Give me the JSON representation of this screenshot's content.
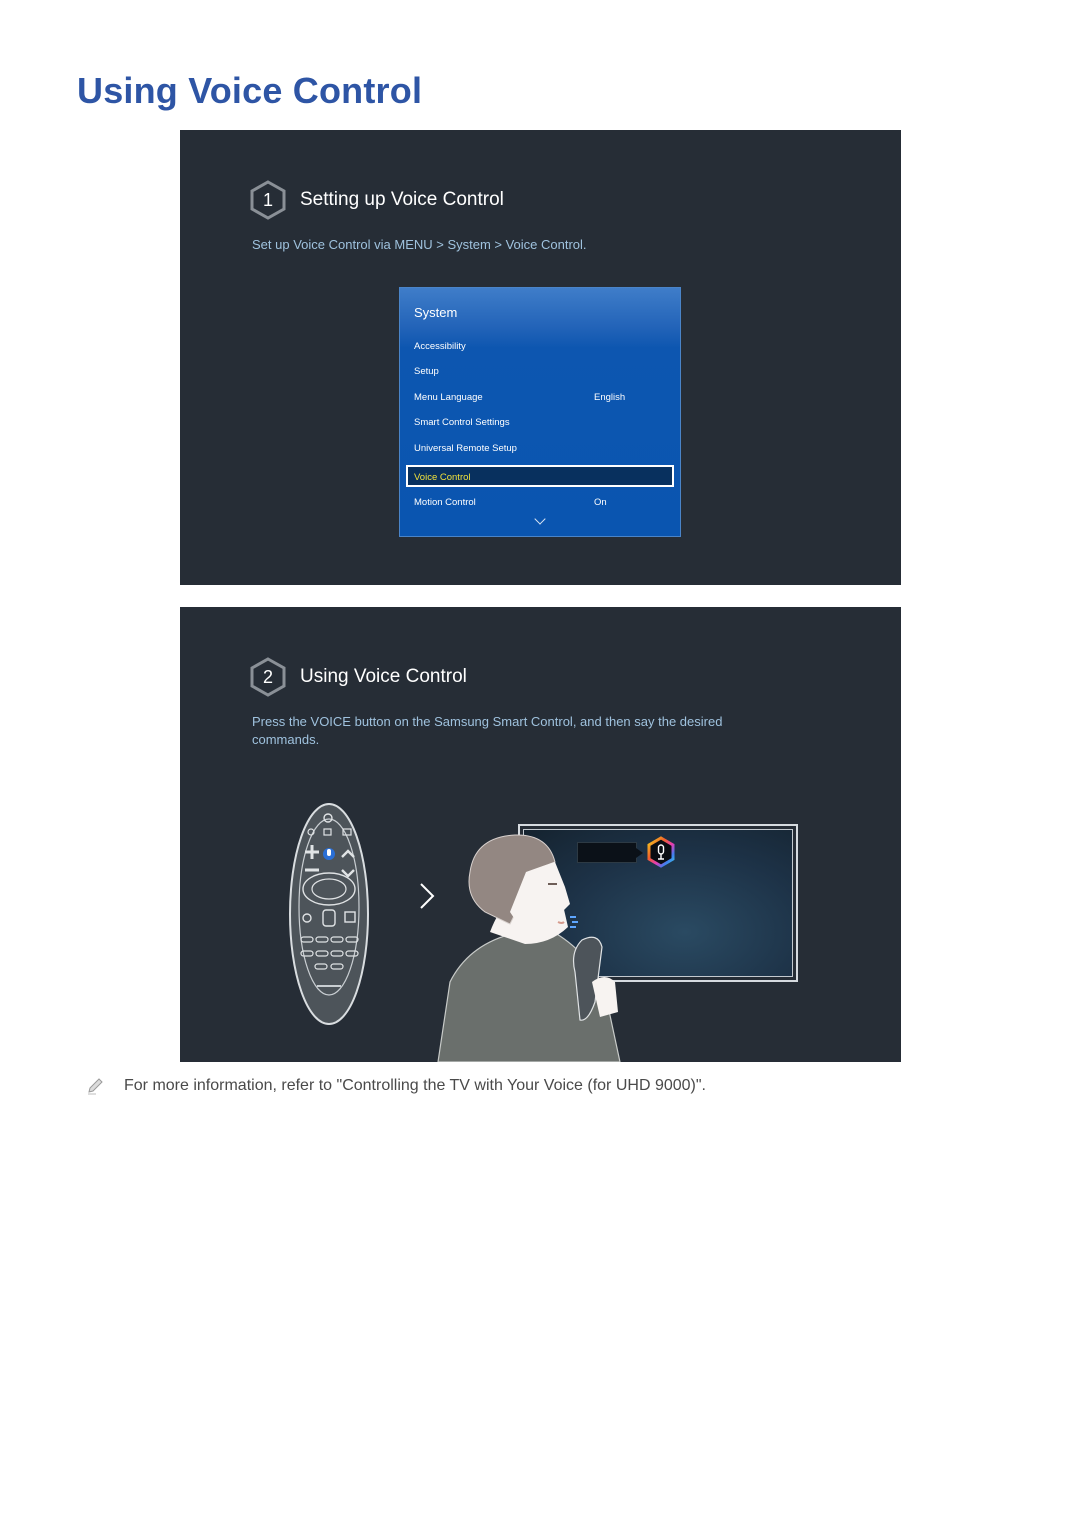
{
  "page": {
    "title": "Using Voice Control",
    "accent_color": "#2e55a5"
  },
  "step1": {
    "number": "1",
    "title": "Setting up Voice Control",
    "description": "Set up Voice Control via MENU > System > Voice Control.",
    "menu": {
      "title": "System",
      "items": [
        {
          "label": "Accessibility",
          "value": ""
        },
        {
          "label": "Setup",
          "value": ""
        },
        {
          "label": "Menu Language",
          "value": "English"
        },
        {
          "label": "Smart Control Settings",
          "value": ""
        },
        {
          "label": "Universal Remote Setup",
          "value": ""
        },
        {
          "label": "Voice Control",
          "value": "",
          "selected": true
        },
        {
          "label": "Motion Control",
          "value": "On"
        }
      ],
      "scroll_icon": "chevron-down-icon"
    }
  },
  "step2": {
    "number": "2",
    "title": "Using Voice Control",
    "description": "Press the VOICE button on the Samsung Smart Control, and then say the desired commands.",
    "illustration": {
      "remote_icon": "smart-control-remote",
      "voice_button_icon": "microphone-icon",
      "arrow_icon": "chevron-right-icon",
      "tv_icon": "tv-screen",
      "voice_indicator_icon": "microphone-hexagon-icon",
      "person_icon": "person-speaking"
    }
  },
  "note": {
    "icon": "pencil-icon",
    "text": "For more information, refer to \"Controlling the TV with Your Voice (for UHD 9000)\"."
  }
}
